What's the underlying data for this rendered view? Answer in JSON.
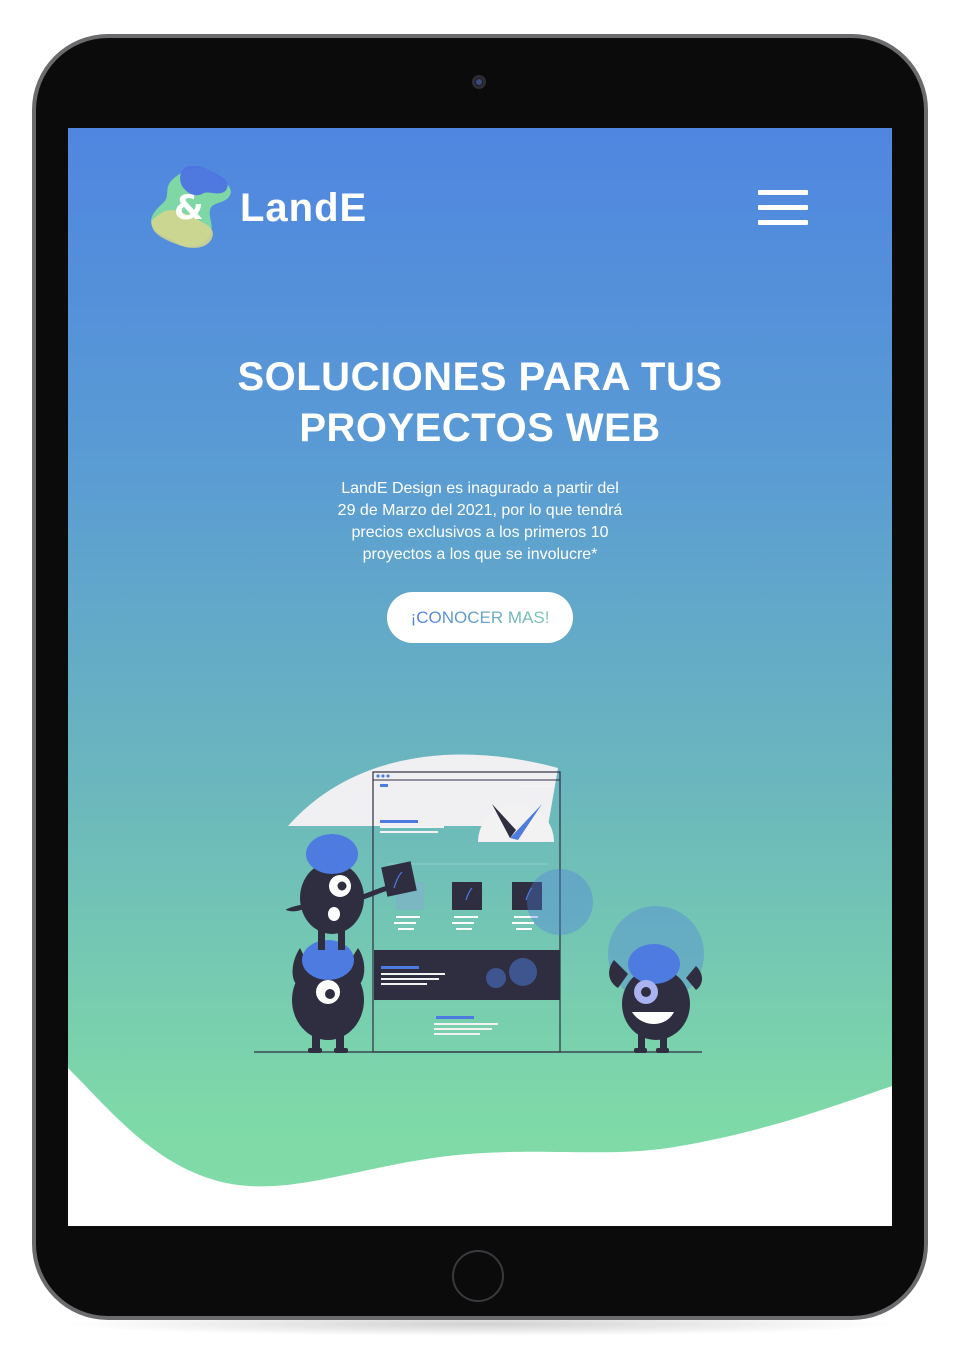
{
  "brand": {
    "logo_symbol": "&",
    "name": "LandE"
  },
  "nav": {
    "menu_icon": "hamburger-menu-icon"
  },
  "hero": {
    "title_line1": "SOLUCIONES PARA TUS",
    "title_line2": "PROYECTOS WEB",
    "description_lines": [
      "LandE Design es inagurado a partir del",
      "29 de Marzo del 2021, por lo que tendrá",
      "precios exclusivos a los primeros 10",
      "proyectos a los que se involucre*"
    ],
    "cta_label": "¡CONOCER MAS!"
  },
  "colors": {
    "gradient_top": "#4f86e0",
    "gradient_bottom": "#82dca8",
    "accent_blue": "#4d7be0",
    "character_dark": "#2f2e41"
  }
}
